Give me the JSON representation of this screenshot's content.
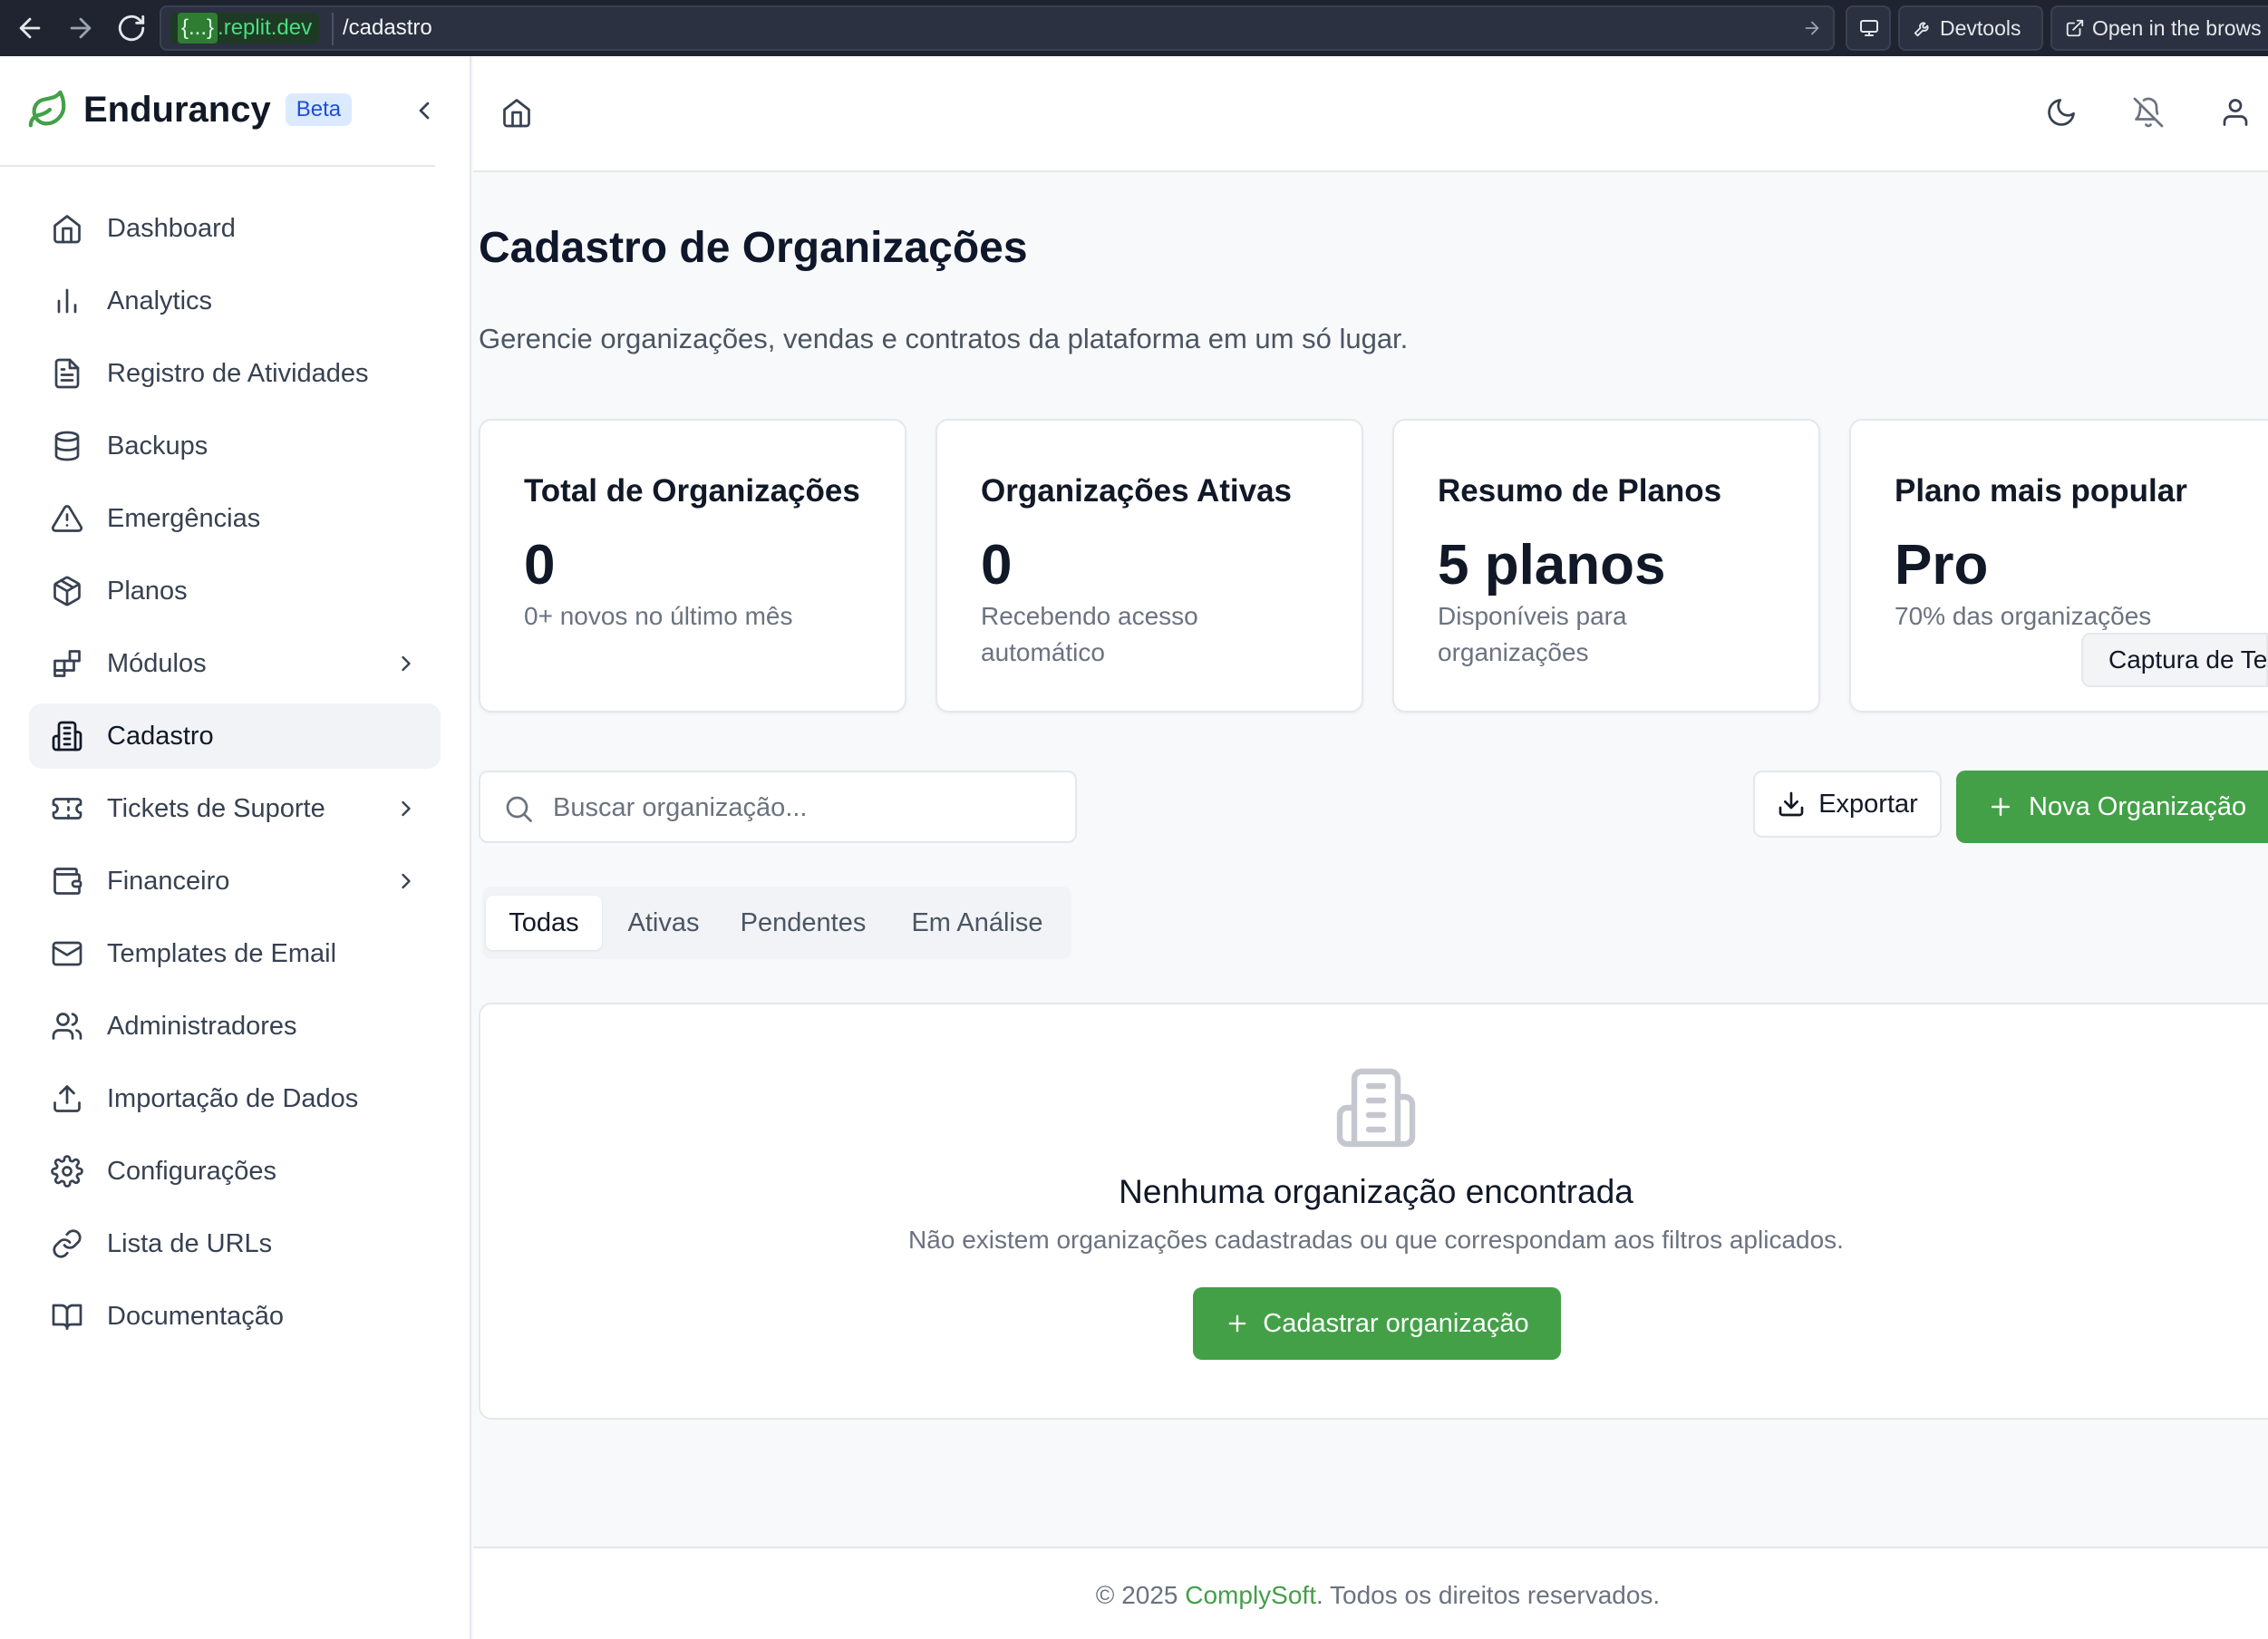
{
  "browser": {
    "url_brace": "{...}",
    "url_domain": ".replit.dev",
    "url_path": "/cadastro",
    "devtools_label": "Devtools",
    "open_label": "Open in the brows"
  },
  "sidebar": {
    "brand": "Endurancy",
    "beta": "Beta",
    "items": [
      {
        "label": "Dashboard",
        "icon": "home-icon"
      },
      {
        "label": "Analytics",
        "icon": "bar-chart-icon"
      },
      {
        "label": "Registro de Atividades",
        "icon": "file-text-icon"
      },
      {
        "label": "Backups",
        "icon": "database-icon"
      },
      {
        "label": "Emergências",
        "icon": "alert-triangle-icon"
      },
      {
        "label": "Planos",
        "icon": "package-icon"
      },
      {
        "label": "Módulos",
        "icon": "blocks-icon"
      },
      {
        "label": "Cadastro",
        "icon": "building-icon"
      },
      {
        "label": "Tickets de Suporte",
        "icon": "ticket-icon"
      },
      {
        "label": "Financeiro",
        "icon": "wallet-icon"
      },
      {
        "label": "Templates de Email",
        "icon": "mail-icon"
      },
      {
        "label": "Administradores",
        "icon": "users-icon"
      },
      {
        "label": "Importação de Dados",
        "icon": "upload-icon"
      },
      {
        "label": "Configurações",
        "icon": "gear-icon"
      },
      {
        "label": "Lista de URLs",
        "icon": "link-icon"
      },
      {
        "label": "Documentação",
        "icon": "book-icon"
      }
    ],
    "active_item": "Cadastro"
  },
  "header": {
    "title": "Cadastro de Organizações",
    "subtitle": "Gerencie organizações, vendas e contratos da plataforma em um só lugar."
  },
  "stats": [
    {
      "title": "Total de Organizações",
      "value": "0",
      "sub": "0+ novos no último mês"
    },
    {
      "title": "Organizações Ativas",
      "value": "0",
      "sub": "Recebendo acesso automático"
    },
    {
      "title": "Resumo de Planos",
      "value": "5 planos",
      "sub": "Disponíveis para organizações"
    },
    {
      "title": "Plano mais popular",
      "value": "Pro",
      "sub": "70% das organizações"
    }
  ],
  "tooltip": "Captura de Te",
  "toolbar": {
    "search_placeholder": "Buscar organização...",
    "export_label": "Exportar",
    "new_label": "Nova Organização"
  },
  "tabs": [
    "Todas",
    "Ativas",
    "Pendentes",
    "Em Análise"
  ],
  "active_tab": "Todas",
  "empty": {
    "title": "Nenhuma organização encontrada",
    "description": "Não existem organizações cadastradas ou que correspondam aos filtros aplicados.",
    "cta": "Cadastrar organização"
  },
  "footer": {
    "prefix": "© 2025 ",
    "brand": "ComplySoft",
    "suffix": ". Todos os direitos reservados."
  },
  "colors": {
    "accent": "#43a047",
    "beta_bg": "#dbeafe",
    "beta_text": "#1d4ed8"
  }
}
